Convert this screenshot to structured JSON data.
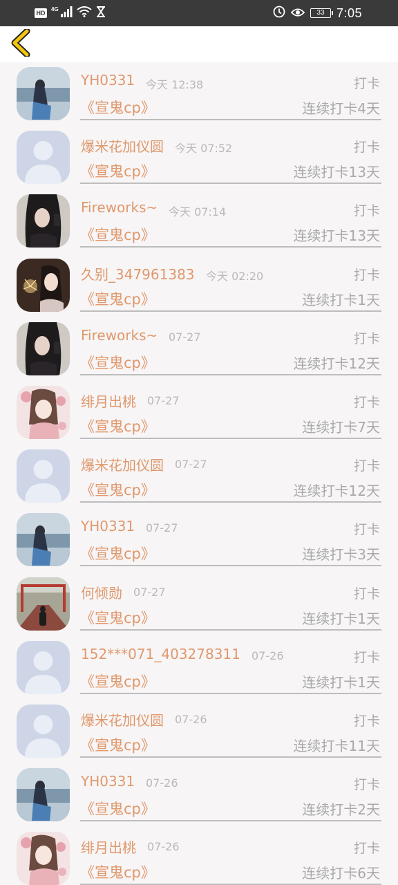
{
  "status_bar": {
    "hd_badge": "HD",
    "network_generation": "4G",
    "battery_level": "33",
    "time": "7:05",
    "icons": [
      "hd-icon",
      "signal-icon",
      "wifi-icon",
      "hourglass-icon",
      "alarm-icon",
      "eye-icon",
      "battery-icon"
    ]
  },
  "header": {
    "back_icon": "chevron-left-icon",
    "accent_color": "#f4c60c"
  },
  "colors": {
    "name": "#e0986c",
    "meta": "#a9a9a9",
    "divider": "#bdbdbd",
    "background": "#f7f5f6"
  },
  "checkins": [
    {
      "name": "YH0331",
      "time": "今天 12:38",
      "type": "打卡",
      "topic": "《宣鬼cp》",
      "streak": "连续打卡4天",
      "avatar": "sea-girl-avatar"
    },
    {
      "name": "爆米花加仪圆",
      "time": "今天 07:52",
      "type": "打卡",
      "topic": "《宣鬼cp》",
      "streak": "连续打卡13天",
      "avatar": "default-avatar"
    },
    {
      "name": "Fireworks~",
      "time": "今天 07:14",
      "type": "打卡",
      "topic": "《宣鬼cp》",
      "streak": "连续打卡13天",
      "avatar": "dark-hair-selfie-avatar"
    },
    {
      "name": "久别_347961383",
      "time": "今天 02:20",
      "type": "打卡",
      "topic": "《宣鬼cp》",
      "streak": "连续打卡1天",
      "avatar": "sparkler-girl-avatar"
    },
    {
      "name": "Fireworks~",
      "time": "07-27",
      "type": "打卡",
      "topic": "《宣鬼cp》",
      "streak": "连续打卡12天",
      "avatar": "dark-hair-selfie-avatar"
    },
    {
      "name": "绯月出桃",
      "time": "07-27",
      "type": "打卡",
      "topic": "《宣鬼cp》",
      "streak": "连续打卡7天",
      "avatar": "anime-girl-avatar"
    },
    {
      "name": "爆米花加仪圆",
      "time": "07-27",
      "type": "打卡",
      "topic": "《宣鬼cp》",
      "streak": "连续打卡12天",
      "avatar": "default-avatar"
    },
    {
      "name": "YH0331",
      "time": "07-27",
      "type": "打卡",
      "topic": "《宣鬼cp》",
      "streak": "连续打卡3天",
      "avatar": "sea-girl-avatar"
    },
    {
      "name": "何倾勋",
      "time": "07-27",
      "type": "打卡",
      "topic": "《宣鬼cp》",
      "streak": "连续打卡1天",
      "avatar": "red-bridge-avatar"
    },
    {
      "name": "152***071_403278311",
      "time": "07-26",
      "type": "打卡",
      "topic": "《宣鬼cp》",
      "streak": "连续打卡1天",
      "avatar": "default-avatar"
    },
    {
      "name": "爆米花加仪圆",
      "time": "07-26",
      "type": "打卡",
      "topic": "《宣鬼cp》",
      "streak": "连续打卡11天",
      "avatar": "default-avatar"
    },
    {
      "name": "YH0331",
      "time": "07-26",
      "type": "打卡",
      "topic": "《宣鬼cp》",
      "streak": "连续打卡2天",
      "avatar": "sea-girl-avatar"
    },
    {
      "name": "绯月出桃",
      "time": "07-26",
      "type": "打卡",
      "topic": "《宣鬼cp》",
      "streak": "连续打卡6天",
      "avatar": "anime-girl-avatar"
    }
  ]
}
